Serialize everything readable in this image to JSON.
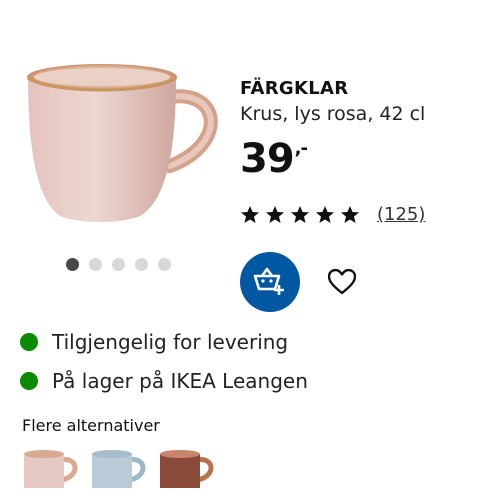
{
  "product": {
    "name": "FÄRGKLAR",
    "description": "Krus, lys rosa, 42 cl",
    "price_integer": "39",
    "price_fraction": ",-",
    "rating_stars": 5,
    "review_count": "(125)",
    "image_icon": "pink-mug-image"
  },
  "carousel": {
    "total": 5,
    "active_index": 0
  },
  "actions": {
    "cart_icon": "add-to-cart-icon",
    "favourite_icon": "heart-icon"
  },
  "availability": [
    {
      "text": "Tilgjengelig for levering",
      "status_color": "#0a8a00"
    },
    {
      "text": "På lager på IKEA Leangen",
      "status_color": "#0a8a00"
    }
  ],
  "alternatives": {
    "title": "Flere alternativer",
    "items": [
      {
        "icon": "pink-mug-thumb",
        "color": "#e6c8c2"
      },
      {
        "icon": "blue-mug-thumb",
        "color": "#b8cbd6"
      },
      {
        "icon": "brown-mug-thumb",
        "color": "#8a4a3a"
      }
    ]
  },
  "colors": {
    "brand_blue": "#0058a3",
    "available_green": "#0a8a00"
  }
}
